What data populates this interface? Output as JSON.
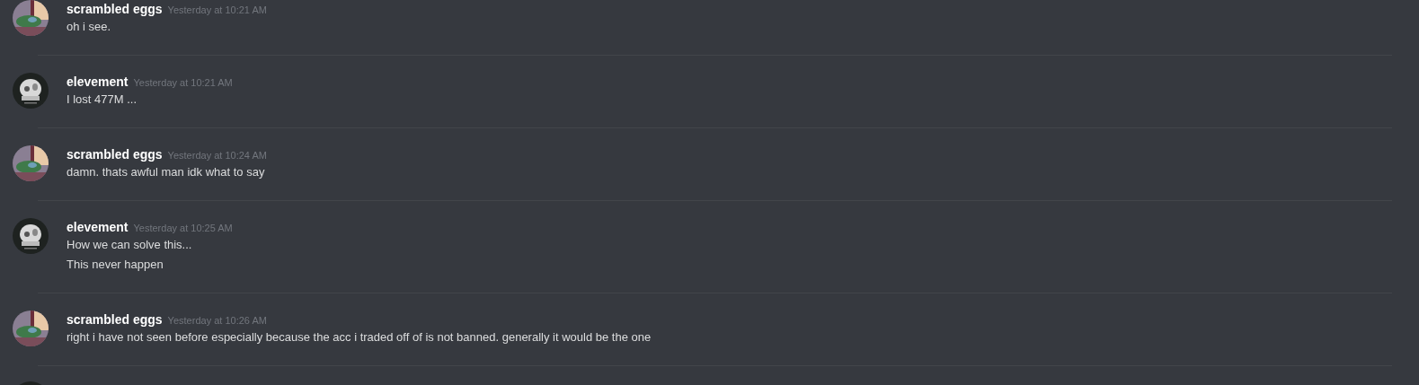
{
  "messages": [
    {
      "author": "scrambled eggs",
      "timestamp": "Yesterday at 10:21 AM",
      "lines": [
        "oh i see."
      ]
    },
    {
      "author": "elevement",
      "timestamp": "Yesterday at 10:21 AM",
      "lines": [
        "I lost 477M ..."
      ]
    },
    {
      "author": "scrambled eggs",
      "timestamp": "Yesterday at 10:24 AM",
      "lines": [
        "damn. thats awful man idk what to say"
      ]
    },
    {
      "author": "elevement",
      "timestamp": "Yesterday at 10:25 AM",
      "lines": [
        "How we can solve this...",
        "This never happen"
      ]
    },
    {
      "author": "scrambled eggs",
      "timestamp": "Yesterday at 10:26 AM",
      "lines": [
        "right i have not seen before especially because the acc i traded off of is not banned. generally it would be the one"
      ]
    }
  ]
}
